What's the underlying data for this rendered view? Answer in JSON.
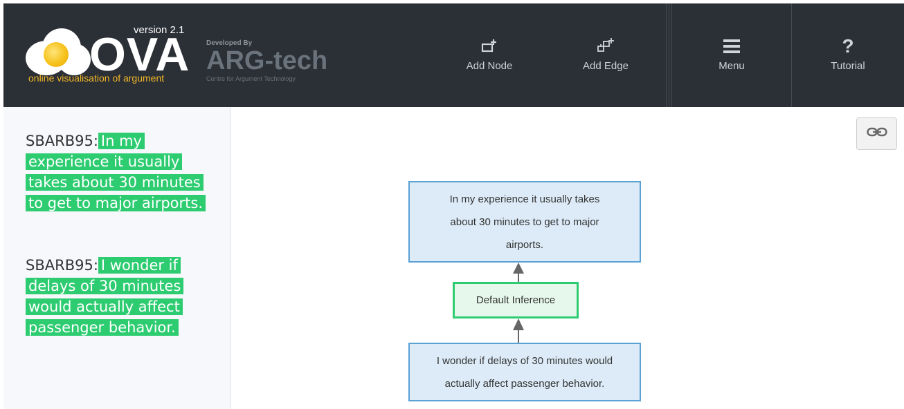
{
  "header": {
    "app_name": "OVA",
    "version": "version 2.1",
    "tagline": "online visualisation of argument",
    "developer": {
      "developed_by": "Developed By",
      "name": "ARG-tech",
      "subtitle": "Centre for Argument Technology"
    },
    "nav": {
      "add_node": "Add Node",
      "add_edge": "Add Edge",
      "menu": "Menu",
      "tutorial": "Tutorial"
    },
    "colors": {
      "background": "#2b2f36",
      "tagline": "#f2b827"
    }
  },
  "transcript": {
    "turns": [
      {
        "speaker": "SBARB95:",
        "text": "In my experience it usually takes about 30 minutes to get to major airports."
      },
      {
        "speaker": "SBARB95:",
        "text": "I wonder if delays of 30 minutes would actually affect passenger behavior."
      }
    ],
    "highlight_color": "#2ecc71"
  },
  "canvas": {
    "link_icon": "link-icon",
    "nodes": {
      "conclusion": {
        "type": "I-node",
        "lines": [
          "In my experience it usually takes",
          "about 30 minutes to get to major",
          "airports."
        ]
      },
      "inference": {
        "type": "RA-node",
        "text": "Default Inference"
      },
      "premise": {
        "type": "I-node",
        "lines": [
          "I wonder if delays of 30 minutes would",
          "actually affect passenger behavior."
        ]
      }
    },
    "colors": {
      "inode_fill": "#dcebf7",
      "inode_border": "#5aa1d4",
      "ra_fill": "#e6f8ec",
      "ra_border": "#2ecc71",
      "edge": "#666666"
    }
  }
}
